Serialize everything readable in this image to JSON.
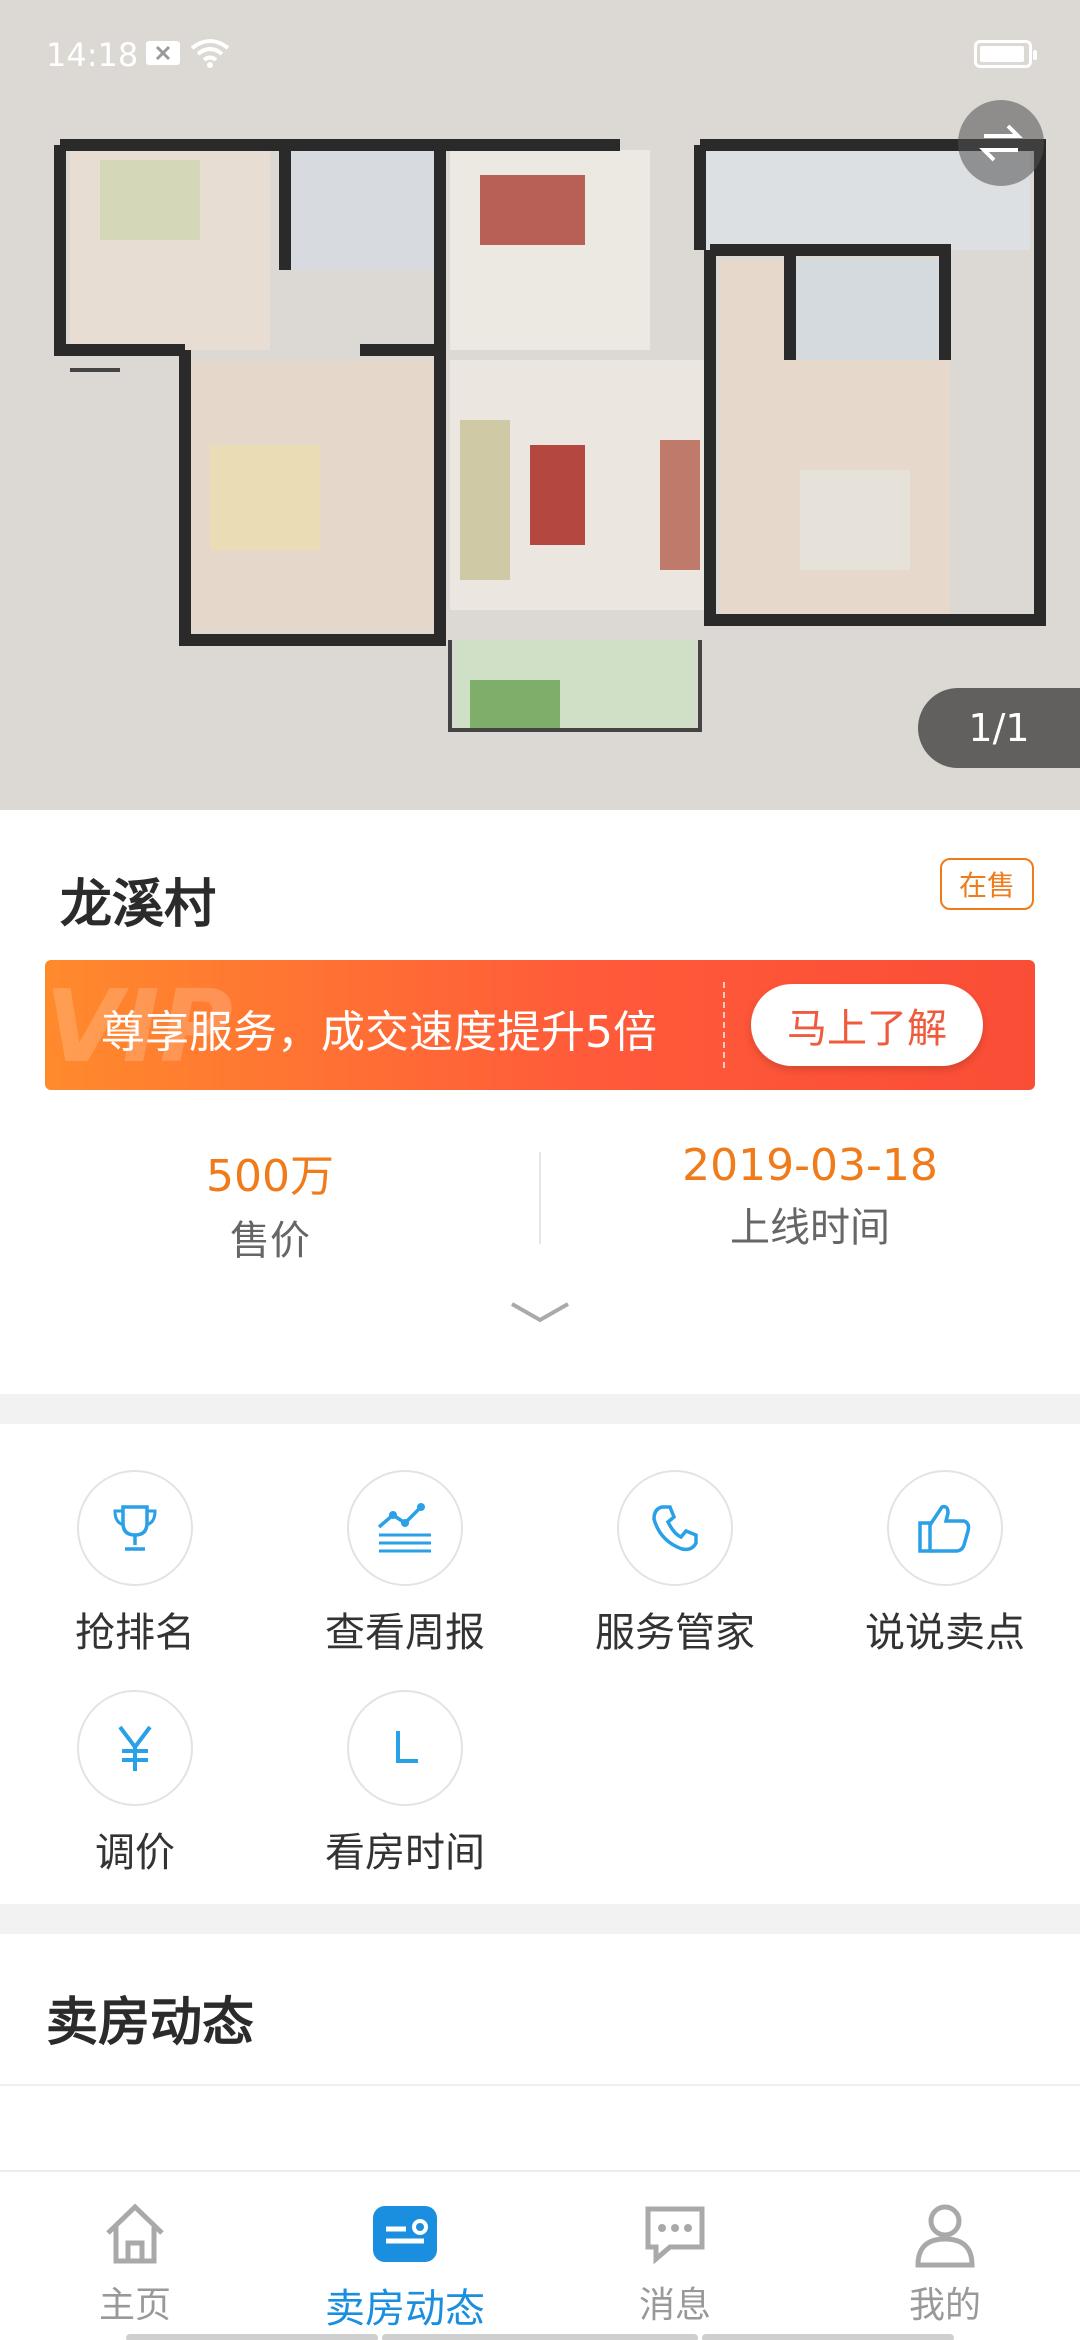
{
  "status_bar": {
    "time": "14:18"
  },
  "gallery": {
    "counter": "1/1"
  },
  "listing": {
    "title": "龙溪村",
    "status_badge": "在售",
    "vip_banner": {
      "watermark": "VIP",
      "text": "尊享服务，成交速度提升5倍",
      "button": "马上了解"
    },
    "stats": [
      {
        "value": "500万",
        "label": "售价"
      },
      {
        "value": "2019-03-18",
        "label": "上线时间"
      }
    ]
  },
  "tools": [
    {
      "label": "抢排名",
      "icon": "trophy-icon"
    },
    {
      "label": "查看周报",
      "icon": "trend-chart-icon"
    },
    {
      "label": "服务管家",
      "icon": "phone-icon"
    },
    {
      "label": "说说卖点",
      "icon": "thumbs-up-icon"
    },
    {
      "label": "调价",
      "icon": "yuan-icon"
    },
    {
      "label": "看房时间",
      "icon": "clock-icon"
    }
  ],
  "section": {
    "title": "卖房动态"
  },
  "nav": {
    "items": [
      {
        "label": "主页",
        "icon": "home-icon",
        "active": false
      },
      {
        "label": "卖房动态",
        "icon": "sell-dynamics-icon",
        "active": true
      },
      {
        "label": "消息",
        "icon": "message-icon",
        "active": false
      },
      {
        "label": "我的",
        "icon": "user-icon",
        "active": false
      }
    ]
  },
  "colors": {
    "accent_orange": "#f07b1a",
    "accent_blue": "#1a8fe0",
    "icon_blue": "#2aa0e6",
    "banner_red": "#fa4d36"
  }
}
